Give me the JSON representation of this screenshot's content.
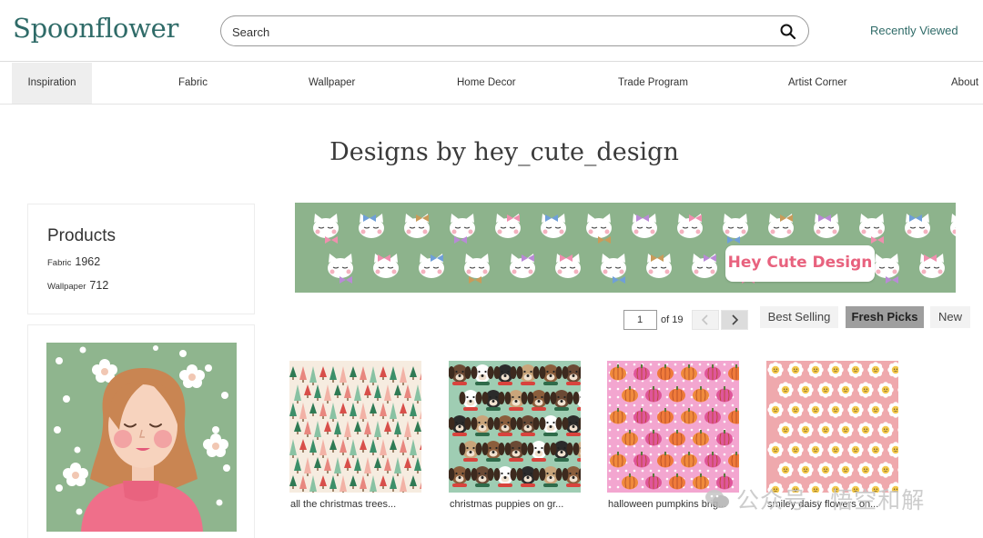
{
  "header": {
    "logo": "Spoonflower",
    "search_placeholder": "Search",
    "recently_viewed": "Recently Viewed"
  },
  "nav": {
    "items": [
      {
        "label": "Inspiration",
        "active": true
      },
      {
        "label": "Fabric"
      },
      {
        "label": "Wallpaper"
      },
      {
        "label": "Home Decor"
      },
      {
        "label": "Trade Program"
      },
      {
        "label": "Artist Corner"
      },
      {
        "label": "About"
      }
    ]
  },
  "page": {
    "title": "Designs by hey_cute_design"
  },
  "products": {
    "title": "Products",
    "items": [
      {
        "label": "Fabric",
        "count": "1962"
      },
      {
        "label": "Wallpaper",
        "count": "712"
      }
    ]
  },
  "banner": {
    "text": "Hey Cute Design"
  },
  "pagination": {
    "current": "1",
    "of_label": "of 19"
  },
  "sort": {
    "options": [
      "Best Selling",
      "Fresh Picks",
      "New"
    ],
    "active": "Fresh Picks"
  },
  "designs": [
    {
      "title": "all the christmas trees..."
    },
    {
      "title": "christmas puppies on gr..."
    },
    {
      "title": "halloween pumpkins brig..."
    },
    {
      "title": "smiley daisy flowers on..."
    }
  ],
  "watermark": {
    "text": "公众号 · 悟空和解"
  },
  "colors": {
    "brand": "#2f6b68",
    "banner_green": "#8db38c",
    "thumb_cream": "#f6ece0",
    "thumb_mint": "#9fcdb3",
    "thumb_pink": "#f3a6d0",
    "thumb_rose": "#efa9ad"
  }
}
